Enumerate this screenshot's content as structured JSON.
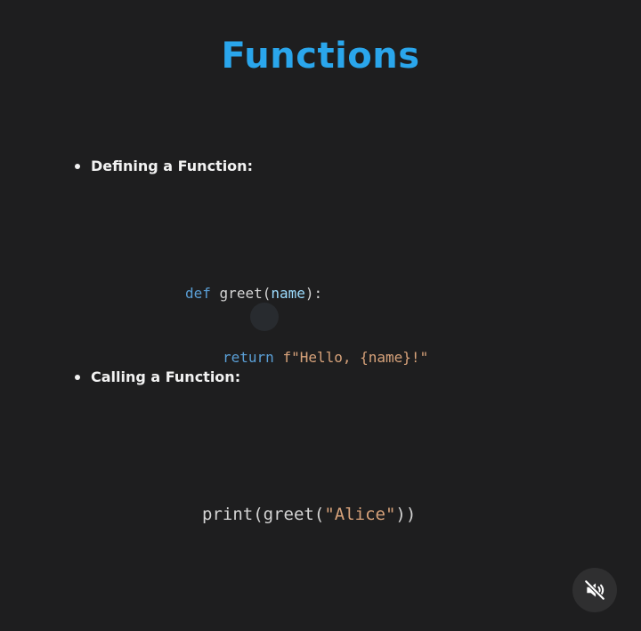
{
  "slide": {
    "title": "Functions",
    "bullets": [
      {
        "label": "Defining a Function:"
      },
      {
        "label": "Calling a Function:"
      }
    ],
    "code_define": {
      "line1": {
        "kw": "def",
        "name": "greet",
        "open": "(",
        "param": "name",
        "close": "):"
      },
      "line2": {
        "kw": "return",
        "str": "f\"Hello, {name}!\""
      }
    },
    "code_call": {
      "fn": "print",
      "open1": "(",
      "inner": "greet",
      "open2": "(",
      "str": "\"Alice\"",
      "close": "))"
    }
  },
  "controls": {
    "mute_icon": "speaker-muted-icon"
  },
  "colors": {
    "title": "#2aa6ec",
    "keyword": "#5a9fd6",
    "string": "#d7a27a",
    "param": "#9cdcfe",
    "background": "#1e1e1f"
  }
}
